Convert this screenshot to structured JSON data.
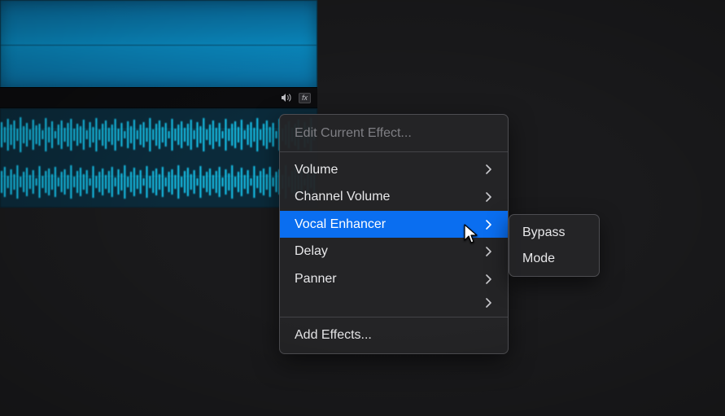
{
  "track": {
    "fx_label": "fx"
  },
  "menu": {
    "header": "Edit Current Effect...",
    "items": [
      {
        "label": "Volume",
        "has_submenu": true
      },
      {
        "label": "Channel Volume",
        "has_submenu": true
      },
      {
        "label": "Vocal Enhancer",
        "has_submenu": true,
        "selected": true
      },
      {
        "label": "Delay",
        "has_submenu": true
      },
      {
        "label": "Panner",
        "has_submenu": true
      }
    ],
    "footer": "Add Effects..."
  },
  "submenu": {
    "items": [
      {
        "label": "Bypass"
      },
      {
        "label": "Mode"
      }
    ]
  },
  "colors": {
    "accent": "#0a6ef0",
    "waveform": "#17d4ff",
    "clip": "#0a8ec6"
  }
}
